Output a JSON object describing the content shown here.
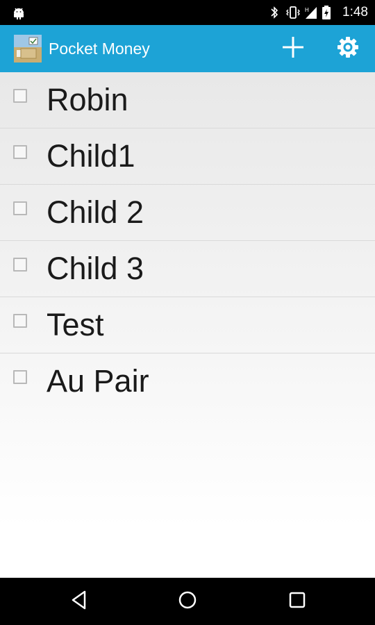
{
  "status_bar": {
    "time": "1:48",
    "icons": [
      "android-debug-icon",
      "bluetooth-icon",
      "vibrate-icon",
      "signal-icon",
      "battery-charging-icon"
    ]
  },
  "action_bar": {
    "title": "Pocket Money",
    "app_icon": "pocket-money-app-icon",
    "actions": [
      "add-icon",
      "settings-gear-icon"
    ],
    "background_color": "#1da3d6"
  },
  "list": {
    "items": [
      {
        "label": "Robin",
        "checked": false
      },
      {
        "label": "Child1",
        "checked": false
      },
      {
        "label": "Child 2",
        "checked": false
      },
      {
        "label": "Child 3",
        "checked": false
      },
      {
        "label": "Test",
        "checked": false
      },
      {
        "label": "Au Pair",
        "checked": false
      }
    ]
  },
  "nav_bar": {
    "buttons": [
      "back-icon",
      "home-icon",
      "recents-icon"
    ]
  }
}
